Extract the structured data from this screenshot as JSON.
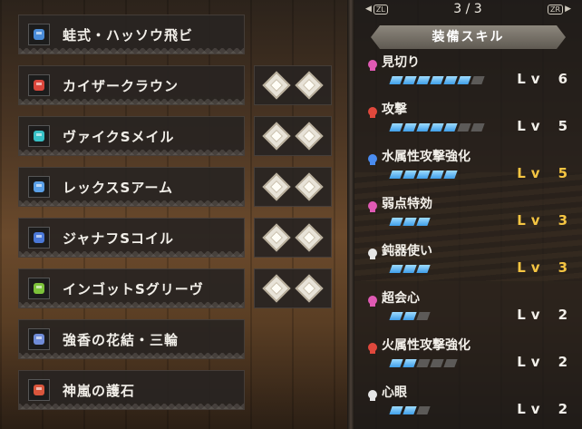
{
  "equipment": [
    {
      "name": "蛙式・ハッソウ飛ビ",
      "icon": "insect-glaive-icon",
      "icon_color": "#4a8cd8",
      "slots": 0
    },
    {
      "name": "カイザークラウン",
      "icon": "helmet-icon",
      "icon_color": "#d9463c",
      "slots": 2
    },
    {
      "name": "ヴァイクSメイル",
      "icon": "chest-armor-icon",
      "icon_color": "#37c1c6",
      "slots": 2
    },
    {
      "name": "レックスSアーム",
      "icon": "arm-armor-icon",
      "icon_color": "#5aa0e8",
      "slots": 2
    },
    {
      "name": "ジャナフSコイル",
      "icon": "waist-armor-icon",
      "icon_color": "#4a78d8",
      "slots": 2
    },
    {
      "name": "インゴットSグリーヴ",
      "icon": "leg-armor-icon",
      "icon_color": "#7cc23a",
      "slots": 2
    },
    {
      "name": "強香の花結・三輪",
      "icon": "kinsect-icon",
      "icon_color": "#6f8cd8",
      "slots": 0
    },
    {
      "name": "神嵐の護石",
      "icon": "charm-icon",
      "icon_color": "#d8553c",
      "slots": 0
    }
  ],
  "panel": {
    "left_button": "ZL",
    "right_button": "ZR",
    "page": "3 / 3",
    "title": "装備スキル"
  },
  "skills": [
    {
      "name": "見切り",
      "icon_color": "#e05ab4",
      "filled": 6,
      "max": 7,
      "level": "6",
      "highlight": false
    },
    {
      "name": "攻撃",
      "icon_color": "#e0483c",
      "filled": 5,
      "max": 7,
      "level": "5",
      "highlight": false
    },
    {
      "name": "水属性攻撃強化",
      "icon_color": "#4a8cf0",
      "filled": 5,
      "max": 5,
      "level": "5",
      "highlight": true
    },
    {
      "name": "弱点特効",
      "icon_color": "#e05ab4",
      "filled": 3,
      "max": 3,
      "level": "3",
      "highlight": true
    },
    {
      "name": "鈍器使い",
      "icon_color": "#e6e6e6",
      "filled": 3,
      "max": 3,
      "level": "3",
      "highlight": true
    },
    {
      "name": "超会心",
      "icon_color": "#e05ab4",
      "filled": 2,
      "max": 3,
      "level": "2",
      "highlight": false
    },
    {
      "name": "火属性攻撃強化",
      "icon_color": "#e0483c",
      "filled": 2,
      "max": 5,
      "level": "2",
      "highlight": false
    },
    {
      "name": "心眼",
      "icon_color": "#e6e6e6",
      "filled": 2,
      "max": 3,
      "level": "2",
      "highlight": false
    }
  ],
  "lv_label": "Lv"
}
